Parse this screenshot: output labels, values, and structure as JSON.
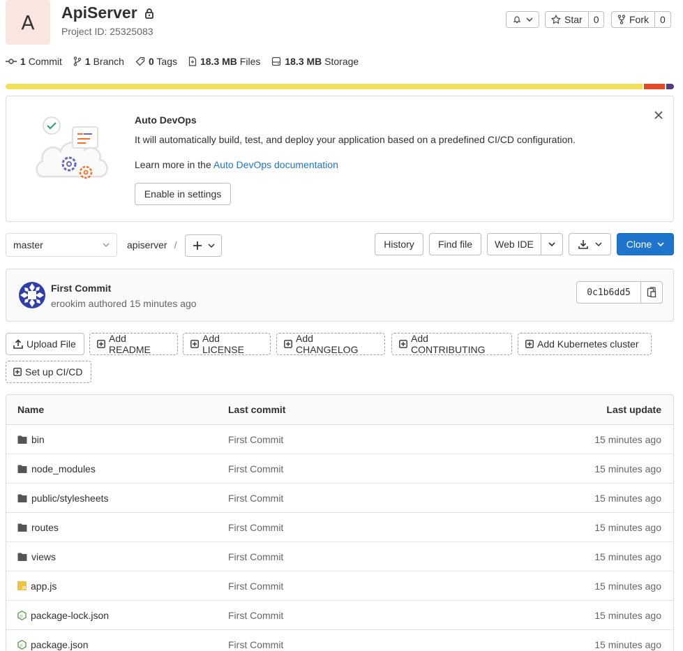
{
  "project": {
    "avatar_letter": "A",
    "name": "ApiServer",
    "project_id": "Project ID: 25325083"
  },
  "actions": {
    "star_label": "Star",
    "star_count": "0",
    "fork_label": "Fork",
    "fork_count": "0"
  },
  "stats": {
    "commits_num": "1",
    "commits_label": "Commit",
    "branches_num": "1",
    "branches_label": "Branch",
    "tags_num": "0",
    "tags_label": "Tags",
    "files_num": "18.3 MB",
    "files_label": "Files",
    "storage_num": "18.3 MB",
    "storage_label": "Storage"
  },
  "languages": [
    {
      "fraction": 0.957,
      "color": "#f1e05a"
    },
    {
      "fraction": 0.031,
      "color": "#e34c26"
    },
    {
      "fraction": 0.012,
      "color": "#563d7c"
    }
  ],
  "devops": {
    "title": "Auto DevOps",
    "description": "It will automatically build, test, and deploy your application based on a predefined CI/CD configuration.",
    "learn_prefix": "Learn more in the",
    "learn_link": "Auto DevOps documentation",
    "enable_button": "Enable in settings"
  },
  "repo": {
    "branch": "master",
    "path": "apiserver",
    "separator": "/",
    "history_button": "History",
    "find_file_button": "Find file",
    "web_ide_button": "Web IDE",
    "clone_button": "Clone"
  },
  "commit": {
    "title": "First Commit",
    "meta": "erookim authored 15 minutes ago",
    "sha": "0c1b6dd5"
  },
  "quick_actions": [
    {
      "label": "Upload File",
      "style": "solid",
      "icon": "upload-icon"
    },
    {
      "label": "Add README",
      "style": "dashed",
      "icon": "plus-square-icon"
    },
    {
      "label": "Add LICENSE",
      "style": "dashed",
      "icon": "plus-square-icon"
    },
    {
      "label": "Add CHANGELOG",
      "style": "dashed",
      "icon": "plus-square-icon"
    },
    {
      "label": "Add CONTRIBUTING",
      "style": "dashed",
      "icon": "plus-square-icon"
    },
    {
      "label": "Add Kubernetes cluster",
      "style": "dashed",
      "icon": "plus-square-icon"
    },
    {
      "label": "Set up CI/CD",
      "style": "dashed",
      "icon": "plus-square-icon"
    }
  ],
  "table": {
    "headers": [
      "Name",
      "Last commit",
      "Last update"
    ],
    "rows": [
      {
        "name": "bin",
        "type": "folder",
        "commit": "First Commit",
        "updated": "15 minutes ago"
      },
      {
        "name": "node_modules",
        "type": "folder",
        "commit": "First Commit",
        "updated": "15 minutes ago"
      },
      {
        "name": "public/stylesheets",
        "type": "folder",
        "commit": "First Commit",
        "updated": "15 minutes ago"
      },
      {
        "name": "routes",
        "type": "folder",
        "commit": "First Commit",
        "updated": "15 minutes ago"
      },
      {
        "name": "views",
        "type": "folder",
        "commit": "First Commit",
        "updated": "15 minutes ago"
      },
      {
        "name": "app.js",
        "type": "js",
        "commit": "First Commit",
        "updated": "15 minutes ago"
      },
      {
        "name": "package-lock.json",
        "type": "node",
        "commit": "First Commit",
        "updated": "15 minutes ago"
      },
      {
        "name": "package.json",
        "type": "node",
        "commit": "First Commit",
        "updated": "15 minutes ago"
      }
    ]
  },
  "colors": {
    "link": "#1f75cb",
    "primary": "#1f75cb",
    "avatar_bg": "#fbe5e1"
  }
}
